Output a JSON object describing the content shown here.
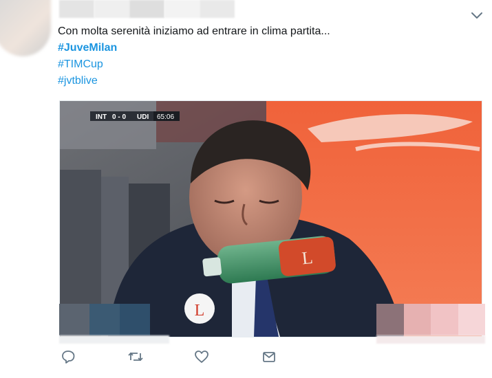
{
  "tweet": {
    "text_lines": [
      "Con molta serenità iniziamo ad entrare in clima partita..."
    ],
    "hashtags": [
      {
        "label": "#JuveMilan",
        "bold": true
      },
      {
        "label": "#TIMCup",
        "bold": false
      },
      {
        "label": "#jvtblive",
        "bold": false
      }
    ]
  },
  "media": {
    "scorebug": {
      "home": "INT",
      "score": "0 - 0",
      "away": "UDI",
      "clock": "65:06"
    },
    "bottle_label": "L",
    "badge_label": "L"
  },
  "actions": [
    {
      "name": "reply",
      "icon": "speech-bubble-icon"
    },
    {
      "name": "retweet",
      "icon": "retweet-arrows-icon"
    },
    {
      "name": "like",
      "icon": "heart-icon"
    },
    {
      "name": "message",
      "icon": "envelope-icon"
    }
  ],
  "colors": {
    "hashtag": "#1b95e0",
    "text": "#14171a",
    "icon": "#657786"
  }
}
